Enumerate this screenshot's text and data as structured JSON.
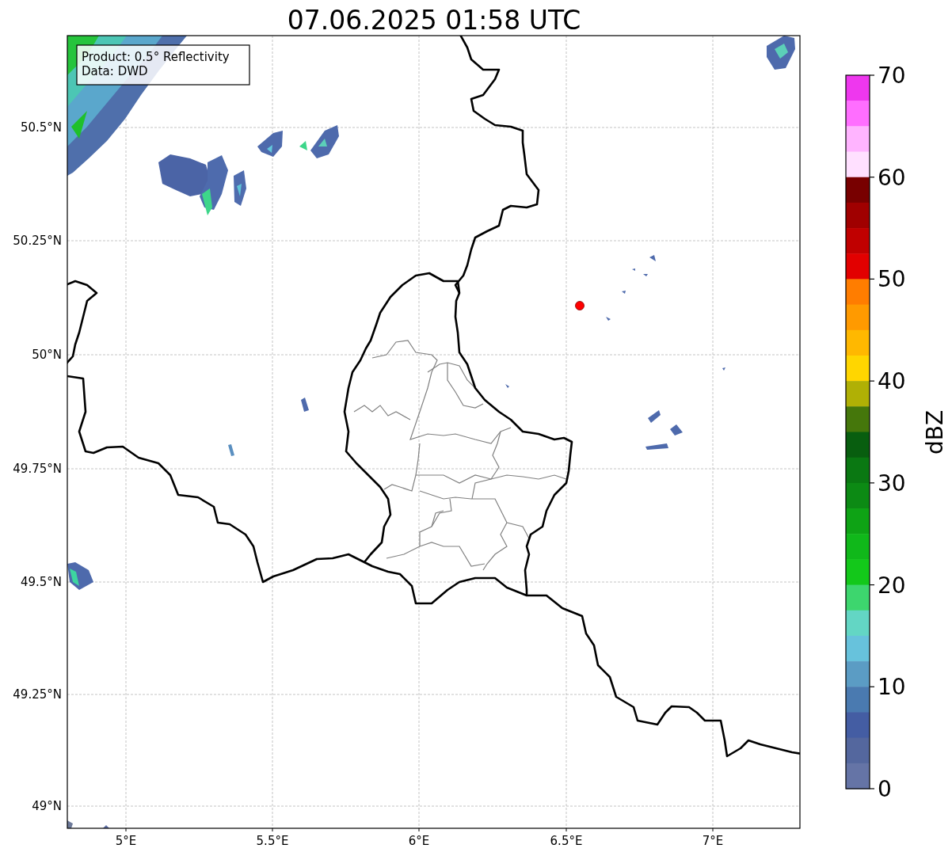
{
  "title": "07.06.2025 01:58 UTC",
  "legend": [
    "Product: 0.5° Reflectivity",
    "Data: DWD"
  ],
  "map": {
    "x_ticks": [
      "5°E",
      "5.5°E",
      "6°E",
      "6.5°E",
      "7°E"
    ],
    "y_ticks": [
      "50.5°N",
      "50.25°N",
      "50°N",
      "49.75°N",
      "49.5°N",
      "49.25°N",
      "49°N"
    ]
  },
  "colorbar": {
    "label": "dBZ",
    "ticks": [
      "70",
      "60",
      "50",
      "40",
      "30",
      "20",
      "10",
      "0"
    ],
    "bins": [
      {
        "color": "#ee37ee"
      },
      {
        "color": "#ff6eff"
      },
      {
        "color": "#ffb4ff"
      },
      {
        "color": "#ffe0ff"
      },
      {
        "color": "#780000"
      },
      {
        "color": "#a00000"
      },
      {
        "color": "#c00000"
      },
      {
        "color": "#e20000"
      },
      {
        "color": "#ff7d00"
      },
      {
        "color": "#ff9a00"
      },
      {
        "color": "#ffb800"
      },
      {
        "color": "#ffd600"
      },
      {
        "color": "#b0b005"
      },
      {
        "color": "#45770b"
      },
      {
        "color": "#085e0f"
      },
      {
        "color": "#0a7812"
      },
      {
        "color": "#0c8a14"
      },
      {
        "color": "#0ea315"
      },
      {
        "color": "#10b81a"
      },
      {
        "color": "#13c81a"
      },
      {
        "color": "#3dd66e"
      },
      {
        "color": "#63d6c4"
      },
      {
        "color": "#67c2dc"
      },
      {
        "color": "#5b9cc4"
      },
      {
        "color": "#4a7ab0"
      },
      {
        "color": "#445da3"
      },
      {
        "color": "#54679e"
      },
      {
        "color": "#6574a6"
      }
    ]
  }
}
